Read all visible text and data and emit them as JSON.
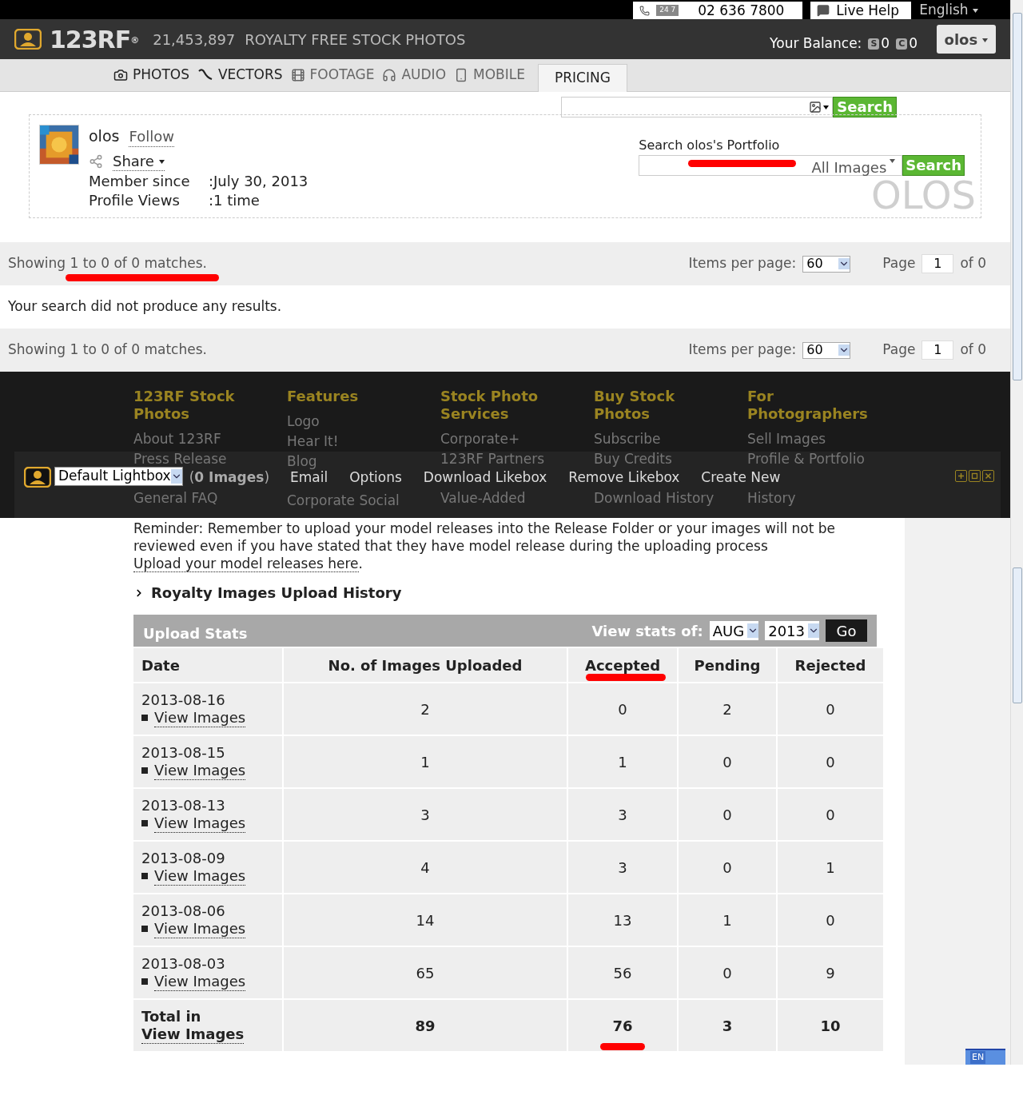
{
  "top_bar": {
    "phone_badge": "24 7",
    "phone": "02 636 7800",
    "live_help": "Live Help",
    "language": "English"
  },
  "header": {
    "logo": "123RF",
    "logo_mark": "®",
    "count": "21,453,897",
    "tagline": "ROYALTY FREE STOCK PHOTOS",
    "balance_label": "Your Balance:",
    "credits": [
      {
        "letter": "S",
        "value": "0"
      },
      {
        "letter": "C",
        "value": "0"
      }
    ],
    "user": "olos"
  },
  "nav": {
    "items": [
      {
        "label": "PHOTOS"
      },
      {
        "label": "VECTORS"
      },
      {
        "label": "FOOTAGE"
      },
      {
        "label": "AUDIO"
      },
      {
        "label": "MOBILE"
      }
    ],
    "pricing": "PRICING"
  },
  "search": {
    "button": "Search"
  },
  "profile": {
    "name": "olos",
    "follow": "Follow",
    "share": "Share",
    "fields": [
      {
        "label": "Member since",
        "value": ":July 30, 2013"
      },
      {
        "label": "Profile Views",
        "value": ":1 time"
      }
    ],
    "portfolio_label": "Search olos's Portfolio",
    "scope": "All Images",
    "button": "Search",
    "watermark": "OLOS"
  },
  "results": {
    "top": {
      "showing": "Showing 1 to 0 of 0 matches.",
      "items_label": "Items per page:",
      "items_value": "60",
      "page_label": "Page",
      "page_value": "1",
      "of": "of 0"
    },
    "message": "Your search did not produce any results.",
    "bottom": {
      "showing": "Showing 1 to 0 of 0 matches.",
      "items_label": "Items per page:",
      "items_value": "60",
      "page_label": "Page",
      "page_value": "1",
      "of": "of 0"
    }
  },
  "footer": {
    "columns": [
      {
        "heading": "123RF Stock Photos",
        "links": [
          "About 123RF",
          "Press Release",
          "General FAQ"
        ]
      },
      {
        "heading": "Features",
        "links": [
          "Logo",
          "Hear It!",
          "Blog",
          "Corporate Social"
        ]
      },
      {
        "heading": "Stock Photo Services",
        "links": [
          "Corporate+",
          "123RF Partners",
          "Value-Added"
        ]
      },
      {
        "heading": "Buy Stock Photos",
        "links": [
          "Subscribe",
          "Buy Credits",
          "Download History"
        ]
      },
      {
        "heading": "For Photographers",
        "links": [
          "Sell Images",
          "Profile & Portfolio",
          "History"
        ]
      }
    ]
  },
  "lightbox": {
    "select": "Default Lightbox",
    "count": "(**0 Images**)",
    "actions": [
      "Email",
      "Options",
      "Download Likebox",
      "Remove Likebox",
      "Create New"
    ]
  },
  "reminder": {
    "text": "Reminder: Remember to upload your model releases into the Release Folder or your images will not be reviewed even if you have stated that they have model release during the uploading process",
    "link": "Upload your model releases here",
    "after": "."
  },
  "history_title": "Royalty Images Upload History",
  "stats": {
    "title": "Upload Stats",
    "view_label": "View stats of:",
    "month": "AUG",
    "year": "2013",
    "go": "Go",
    "columns": [
      "Date",
      "No. of Images Uploaded",
      "Accepted",
      "Pending",
      "Rejected"
    ],
    "rows": [
      {
        "date": "2013-08-16",
        "link": "View Images",
        "uploaded": "2",
        "accepted": "0",
        "pending": "2",
        "rejected": "0"
      },
      {
        "date": "2013-08-15",
        "link": "View Images",
        "uploaded": "1",
        "accepted": "1",
        "pending": "0",
        "rejected": "0"
      },
      {
        "date": "2013-08-13",
        "link": "View Images",
        "uploaded": "3",
        "accepted": "3",
        "pending": "0",
        "rejected": "0"
      },
      {
        "date": "2013-08-09",
        "link": "View Images",
        "uploaded": "4",
        "accepted": "3",
        "pending": "0",
        "rejected": "1"
      },
      {
        "date": "2013-08-06",
        "link": "View Images",
        "uploaded": "14",
        "accepted": "13",
        "pending": "1",
        "rejected": "0"
      },
      {
        "date": "2013-08-03",
        "link": "View Images",
        "uploaded": "65",
        "accepted": "56",
        "pending": "0",
        "rejected": "9"
      },
      {
        "date": "Total in",
        "link": "View Images",
        "uploaded": "89",
        "accepted": "76",
        "pending": "3",
        "rejected": "10",
        "kind": "total"
      }
    ]
  },
  "language_bar": {
    "label": "EN"
  }
}
